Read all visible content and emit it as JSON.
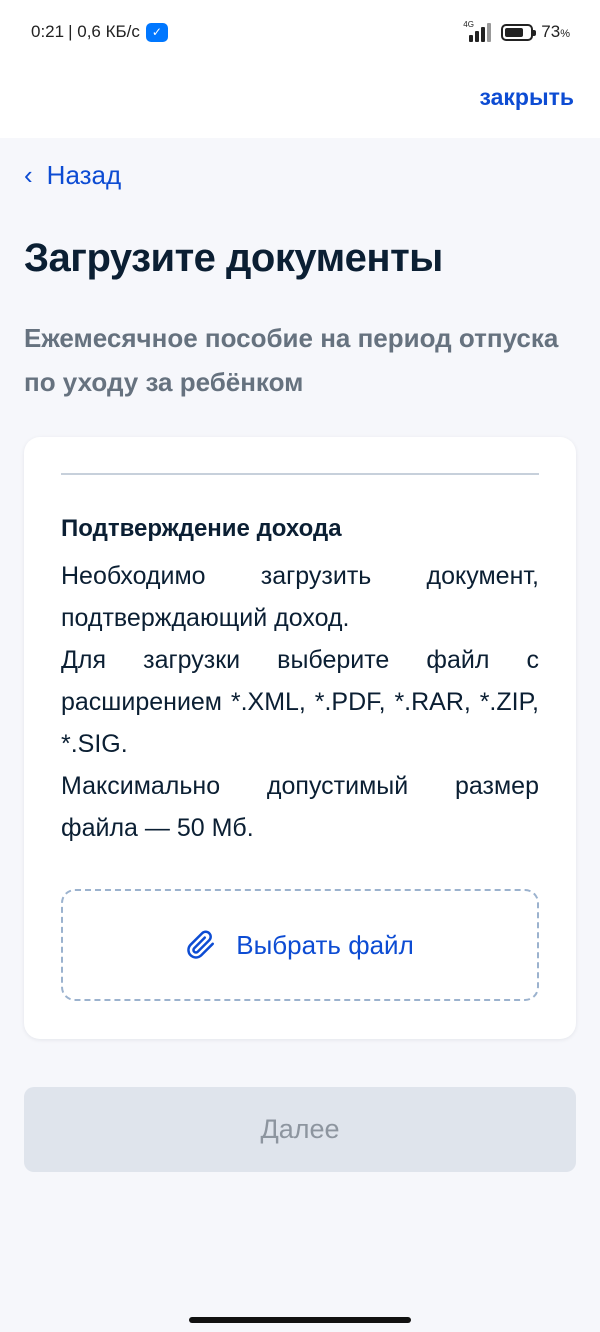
{
  "status_bar": {
    "time": "0:21",
    "network_speed": "| 0,6 КБ/с",
    "vk_icon": "vk-icon",
    "network_type": "4G",
    "battery_percent": "73",
    "battery_unit": "%",
    "battery_level": 0.73
  },
  "header": {
    "close_label": "закрыть"
  },
  "navigation": {
    "back_label": "Назад"
  },
  "page": {
    "title": "Загрузите документы",
    "subtitle": "Ежемесячное пособие на период отпуска по уходу за ребёнком"
  },
  "card": {
    "heading": "Подтверждение дохода",
    "paragraphs": [
      "Необходимо загрузить документ, подтверждающий доход.",
      "Для загрузки выберите файл с расширением *.XML, *.PDF, *.RAR, *.ZIP, *.SIG.",
      "Максимально допустимый размер файла — 50 Мб."
    ],
    "upload_label": "Выбрать файл",
    "upload_icon": "paperclip-icon"
  },
  "actions": {
    "next_label": "Далее"
  },
  "colors": {
    "accent": "#0d4cd3",
    "text": "#0b1f33",
    "muted": "#66727f",
    "background": "#f6f7fb",
    "disabled_button": "#dfe4ec"
  }
}
